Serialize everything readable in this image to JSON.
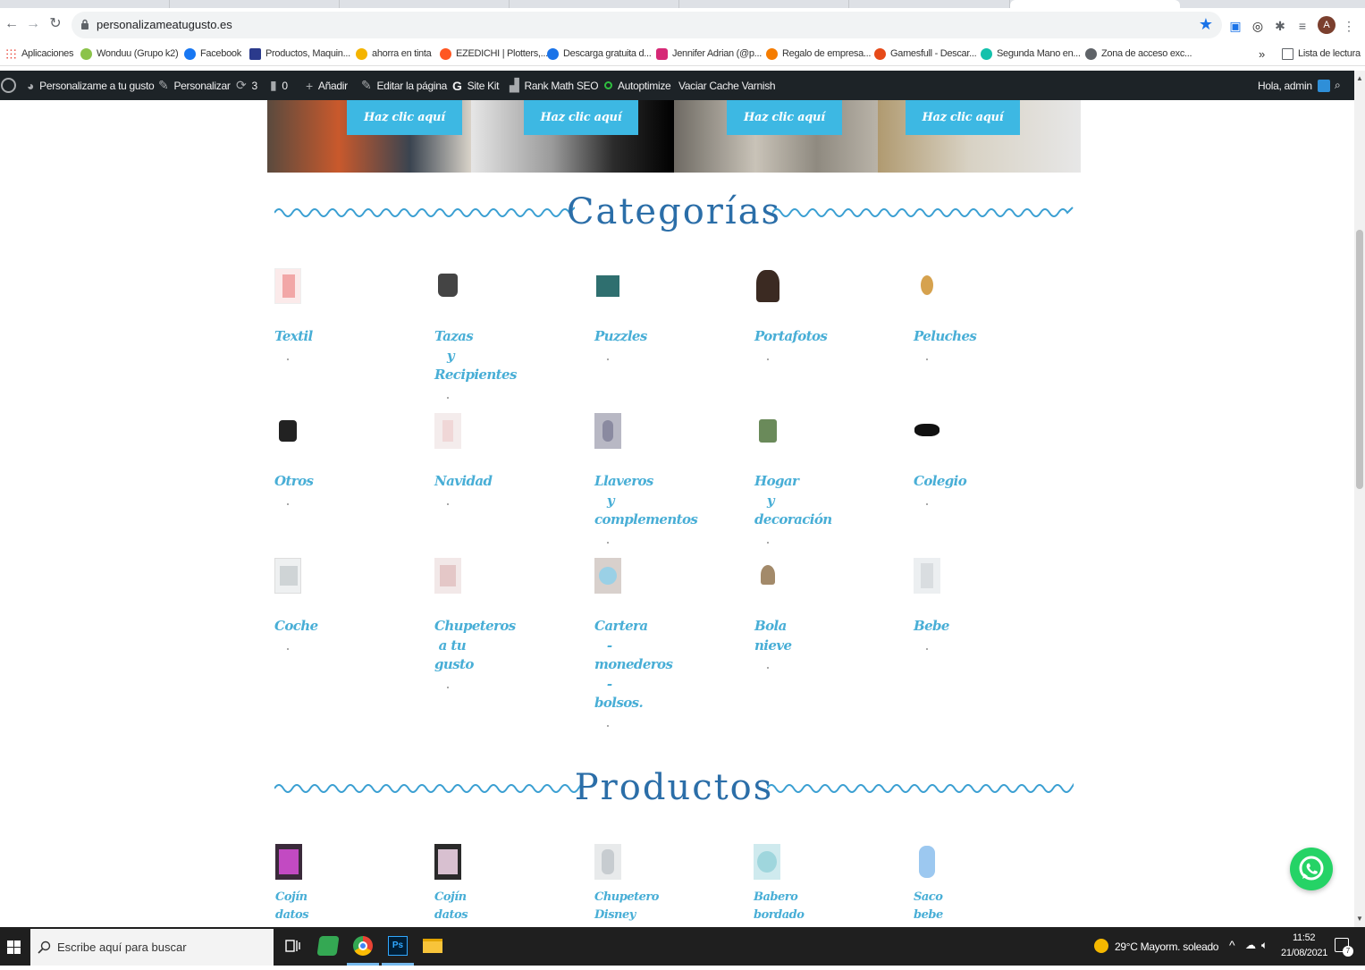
{
  "browser": {
    "url": "personalizameatugusto.es",
    "reading_list": "Lista de lectura",
    "overflow": "»",
    "profile_initial": "A"
  },
  "bookmarks": [
    {
      "label": "Aplicaciones",
      "color": "#e94235"
    },
    {
      "label": "Wonduu (Grupo k2)",
      "color": "#8bc34a"
    },
    {
      "label": "Facebook",
      "color": "#1877f2"
    },
    {
      "label": "Productos, Maquin...",
      "color": "#2b3a8c"
    },
    {
      "label": "ahorra en tinta",
      "color": "#f4b400"
    },
    {
      "label": "EZEDICHI | Plotters,...",
      "color": "#ff5722"
    },
    {
      "label": "Descarga gratuita d...",
      "color": "#1a73e8"
    },
    {
      "label": "Jennifer Adrian (@p...",
      "color": "#d62976"
    },
    {
      "label": "Regalo de empresa...",
      "color": "#f57c00"
    },
    {
      "label": "Gamesfull - Descar...",
      "color": "#e64a19"
    },
    {
      "label": "Segunda Mano en...",
      "color": "#13c1ac"
    },
    {
      "label": "Zona de acceso exc...",
      "color": "#5f6368"
    }
  ],
  "admin_bar": {
    "site_name": "Personalizame a tu gusto",
    "customize": "Personalizar",
    "updates": "3",
    "comments": "0",
    "add_new": "Añadir",
    "edit_page": "Editar la página",
    "site_kit": "Site Kit",
    "rank_math": "Rank Math SEO",
    "autoptimize": "Autoptimize",
    "cache": "Vaciar Cache Varnish",
    "greeting": "Hola, admin"
  },
  "banner": {
    "cta_label": "Haz clic aquí"
  },
  "sections": {
    "categories_title": "Categorías",
    "products_title": "Productos"
  },
  "categories": [
    {
      "name": "Textil",
      "color": "#f2a7a7"
    },
    {
      "name": "Tazas\n   y\nRecipientes",
      "color": "#444"
    },
    {
      "name": "Puzzles",
      "color": "#2f6f6f"
    },
    {
      "name": "Portafotos",
      "color": "#3b2a22"
    },
    {
      "name": "Peluches",
      "color": "#d6a24e"
    },
    {
      "name": "Otros",
      "color": "#222"
    },
    {
      "name": "Navidad",
      "color": "#f0d7d7"
    },
    {
      "name": "Llaveros\n   y\ncomplementos",
      "color": "#8a8aa0"
    },
    {
      "name": "Hogar\n   y\ndecoración",
      "color": "#6a8a5a"
    },
    {
      "name": "Colegio",
      "color": "#111"
    },
    {
      "name": "Coche",
      "color": "#cfd4d6"
    },
    {
      "name": "Chupeteros\n a tu\ngusto",
      "color": "#e4c7c7"
    },
    {
      "name": "Cartera\n   -\nmonederos\n   -\nbolsos.",
      "color": "#9ad0e6"
    },
    {
      "name": "Bola\nnieve",
      "color": "#a38a6a"
    },
    {
      "name": "Bebe",
      "color": "#d9dde0"
    }
  ],
  "products": [
    {
      "name": "Cojín\ndatos\nnacimiento",
      "color": "#c24ac2"
    },
    {
      "name": "Cojín\ndatos\nnacimiento",
      "color": "#d8c0d0"
    },
    {
      "name": "Chupetero\nDisney\n-",
      "color": "#c7ccd0"
    },
    {
      "name": "Babero\nbordado\nbebe",
      "color": "#9fd6dd"
    },
    {
      "name": "Saco\nbebe\nmuelo",
      "color": "#9cc8f0"
    }
  ],
  "taskbar": {
    "search_placeholder": "Escribe aquí para buscar",
    "weather": "29°C  Mayorm. soleado",
    "time": "11:52",
    "date": "21/08/2021",
    "notifications": "7"
  }
}
